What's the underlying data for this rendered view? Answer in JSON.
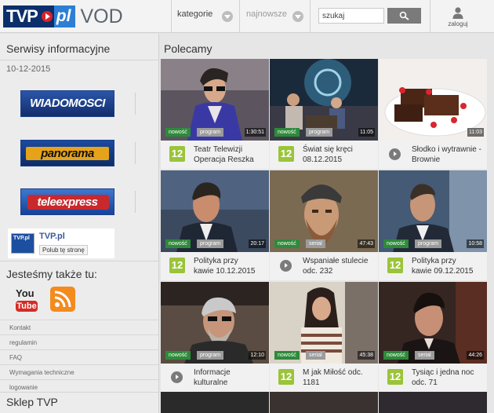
{
  "header": {
    "logo": {
      "tvp": "TVP",
      "pl": "pl",
      "vod": "VOD"
    },
    "nav": {
      "categories": "kategorie",
      "popular": "najnowsze"
    },
    "search": {
      "value": "szukaj",
      "icon": "search-icon"
    },
    "login": {
      "label": "zaloguj",
      "icon": "user-icon"
    }
  },
  "sidebar": {
    "title": "Serwisy informacyjne",
    "date": "10-12-2015",
    "services": [
      {
        "label": "WIADOMOSCI",
        "color": "#1e3f8c"
      },
      {
        "label": "panorama",
        "color": "#17479a"
      },
      {
        "label": "teleexpress",
        "color": "#1d57b0"
      }
    ],
    "facebook": {
      "name": "TVP.pl",
      "like": "Polub tę stronę",
      "logo_text": "TVP.pl"
    },
    "also_title": "Jesteśmy także tu:",
    "social": {
      "youtube_you": "You",
      "youtube_tube": "Tube"
    },
    "links": [
      "Kontakt",
      "regulamin",
      "FAQ",
      "Wymagania techniczne",
      "logowanie"
    ],
    "shop_title": "Sklep TVP"
  },
  "main": {
    "title": "Polecamy",
    "tiles": [
      {
        "title1": "Teatr Telewizji",
        "title2": "Operacja Reszka",
        "channel": "12",
        "new": "nowość",
        "type": "program",
        "duration": "1:30:51"
      },
      {
        "title1": "Świat się kręci",
        "title2": "08.12.2015",
        "channel": "12",
        "new": "nowość",
        "type": "program",
        "duration": "11:05"
      },
      {
        "title1": "Słodko i wytrawnie -",
        "title2": "Brownie",
        "channel": "",
        "new": "",
        "type": "",
        "duration": "11:03"
      },
      {
        "title1": "Polityka przy",
        "title2": "kawie 10.12.2015",
        "channel": "12",
        "new": "nowość",
        "type": "program",
        "duration": "20:17"
      },
      {
        "title1": "Wspaniałe stulecie",
        "title2": "odc. 232",
        "channel": "",
        "new": "nowość",
        "type": "serial",
        "duration": "47:43"
      },
      {
        "title1": "Polityka przy",
        "title2": "kawie 09.12.2015",
        "channel": "12",
        "new": "nowość",
        "type": "program",
        "duration": "10:58"
      },
      {
        "title1": "Informacje",
        "title2": "kulturalne",
        "channel": "",
        "new": "nowość",
        "type": "program",
        "duration": "12:10"
      },
      {
        "title1": "M jak Miłość odc.",
        "title2": "1181",
        "channel": "12",
        "new": "nowość",
        "type": "serial",
        "duration": "45:38"
      },
      {
        "title1": "Tysiąc i jedna noc",
        "title2": "odc. 71",
        "channel": "12",
        "new": "nowość",
        "type": "serial",
        "duration": "44:26"
      }
    ]
  }
}
